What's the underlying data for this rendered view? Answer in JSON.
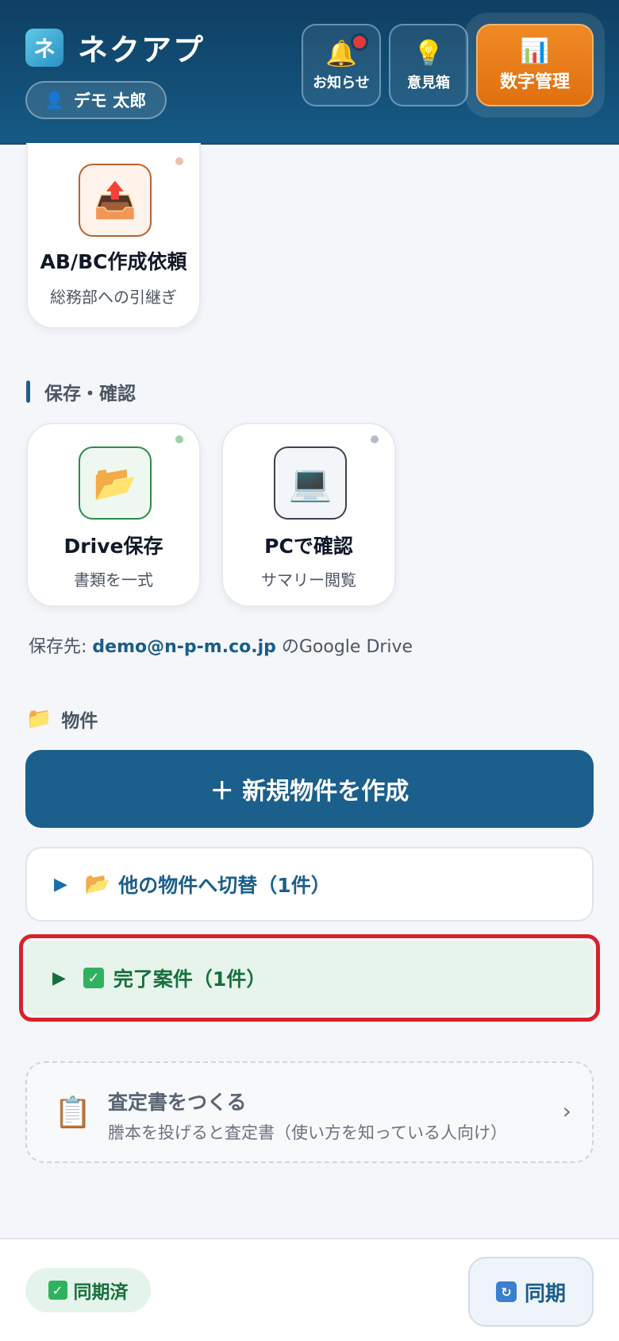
{
  "header": {
    "brand_logo": "ネ",
    "brand_name": "ネクアプ",
    "user_icon": "person-icon",
    "user_name": "デモ 太郎",
    "notice_label": "お知らせ",
    "opinion_label": "意見箱",
    "numbers_label": "数字管理"
  },
  "cards": {
    "abbc": {
      "title": "AB/BC作成依頼",
      "sub": "総務部への引継ぎ",
      "icon": "outbox-upload-icon",
      "dot_color": "#e8c2b0"
    },
    "drive": {
      "title": "Drive保存",
      "sub": "書類を一式",
      "icon": "folder-icon",
      "dot_color": "#9fd1a9"
    },
    "pc": {
      "title": "PCで確認",
      "sub": "サマリー閲覧",
      "icon": "laptop-icon",
      "dot_color": "#b6bcc6"
    }
  },
  "sections": {
    "save": "保存・確認",
    "properties": "物件"
  },
  "save_dest": {
    "prefix": "保存先: ",
    "email": "demo@n-p-m.co.jp",
    "suffix": " のGoogle Drive"
  },
  "properties": {
    "new_button": "＋ 新規物件を作成",
    "switch_label": "他の物件へ切替（1件）",
    "completed_label": "完了案件（1件）"
  },
  "assessment": {
    "title": "査定書をつくる",
    "subtitle": "謄本を投げると査定書（使い方を知っている人向け）"
  },
  "footer": {
    "synced_label": "同期済",
    "sync_button": "同期"
  },
  "colors": {
    "header": "#155a85",
    "accent_orange": "#e0700f",
    "primary": "#1b5f8c",
    "success": "#17703d",
    "highlight": "#d8222a"
  }
}
